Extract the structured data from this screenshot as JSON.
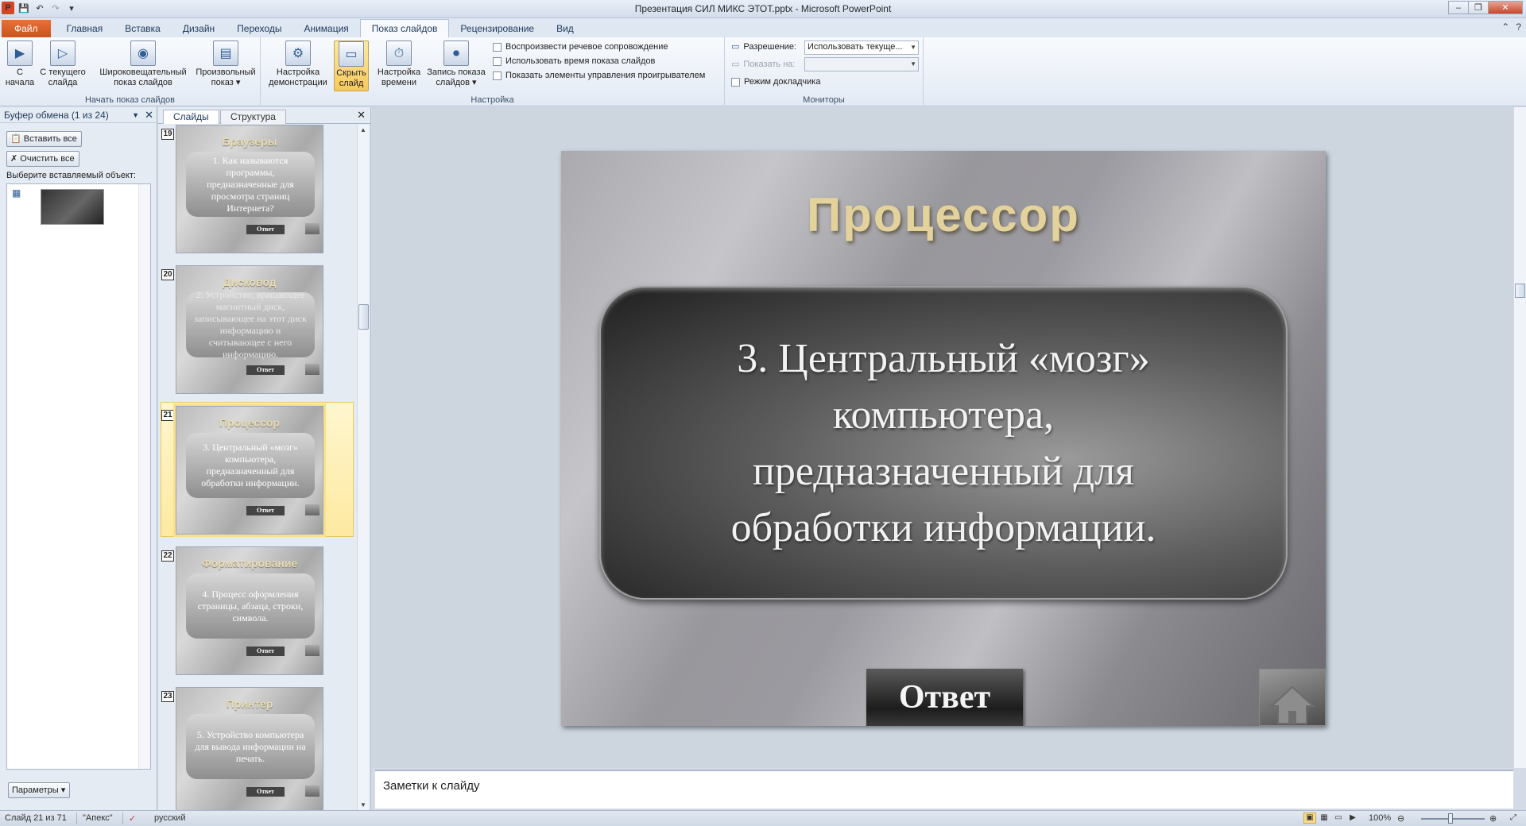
{
  "window": {
    "title": "Презентация СИЛ МИКС ЭТОТ.pptx  -  Microsoft PowerPoint",
    "qat": {
      "app_icon": "P",
      "save_icon": "save-icon",
      "undo_icon": "undo-icon",
      "redo_icon": "redo-icon"
    },
    "controls": {
      "minimize": "–",
      "restore": "❐",
      "close": "✕"
    }
  },
  "ribbon_tabs": [
    "Файл",
    "Главная",
    "Вставка",
    "Дизайн",
    "Переходы",
    "Анимация",
    "Показ слайдов",
    "Рецензирование",
    "Вид"
  ],
  "active_tab": "Показ слайдов",
  "ribbon": {
    "start_group": {
      "label": "Начать показ слайдов",
      "from_start": "С\nначала",
      "from_current": "С текущего\nслайда",
      "broadcast": "Широковещательный\nпоказ слайдов",
      "custom": "Произвольный\nпоказ ▾"
    },
    "setup_group": {
      "label": "Настройка",
      "setup": "Настройка\nдемонстрации",
      "hide": "Скрыть\nслайд",
      "rehearse": "Настройка\nвремени",
      "record": "Запись показа\nслайдов ▾",
      "narration": "Воспроизвести речевое сопровождение",
      "use_timings": "Использовать время показа слайдов",
      "media_controls": "Показать элементы управления проигрывателем"
    },
    "monitors_group": {
      "label": "Мониторы",
      "resolution_label": "Разрешение:",
      "resolution_value": "Использовать текуще...",
      "show_on_label": "Показать на:",
      "show_on_value": "",
      "presenter_view": "Режим докладчика"
    }
  },
  "clipboard_pane": {
    "title": "Буфер обмена (1 из 24)",
    "paste_all": "Вставить все",
    "clear_all": "Очистить все",
    "instruction": "Выберите вставляемый объект:",
    "options": "Параметры"
  },
  "slides_pane": {
    "tabs": [
      "Слайды",
      "Структура"
    ],
    "thumbnails": [
      {
        "num": "19",
        "title": "Браузеры",
        "text": "1. Как называются программы, предназначенные для просмотра страниц Интернета?",
        "answer": "Ответ"
      },
      {
        "num": "20",
        "title": "Дисковод",
        "text": "2. Устройство, вращающее магнитный диск, записывающее на этот диск информацию и считывающее с него информацию.",
        "answer": "Ответ"
      },
      {
        "num": "21",
        "title": "Процессор",
        "text": "3. Центральный «мозг» компьютера, предназначенный для обработки информации.",
        "answer": "Ответ"
      },
      {
        "num": "22",
        "title": "Форматирование",
        "text": "4. Процесс оформления страницы, абзаца, строки, символа.",
        "answer": "Ответ"
      },
      {
        "num": "23",
        "title": "Принтер",
        "text": "5. Устройство компьютера для вывода информации на печать.",
        "answer": "Ответ"
      }
    ]
  },
  "slide": {
    "title": "Процессор",
    "question": "3. Центральный «мозг» компьютера,\nпредназначенный для обработки информации.",
    "answer_button": "Ответ"
  },
  "notes_placeholder": "Заметки к слайду",
  "status": {
    "slide_of": "Слайд 21 из 71",
    "theme": "\"Апекс\"",
    "language": "русский",
    "zoom": "100%"
  }
}
